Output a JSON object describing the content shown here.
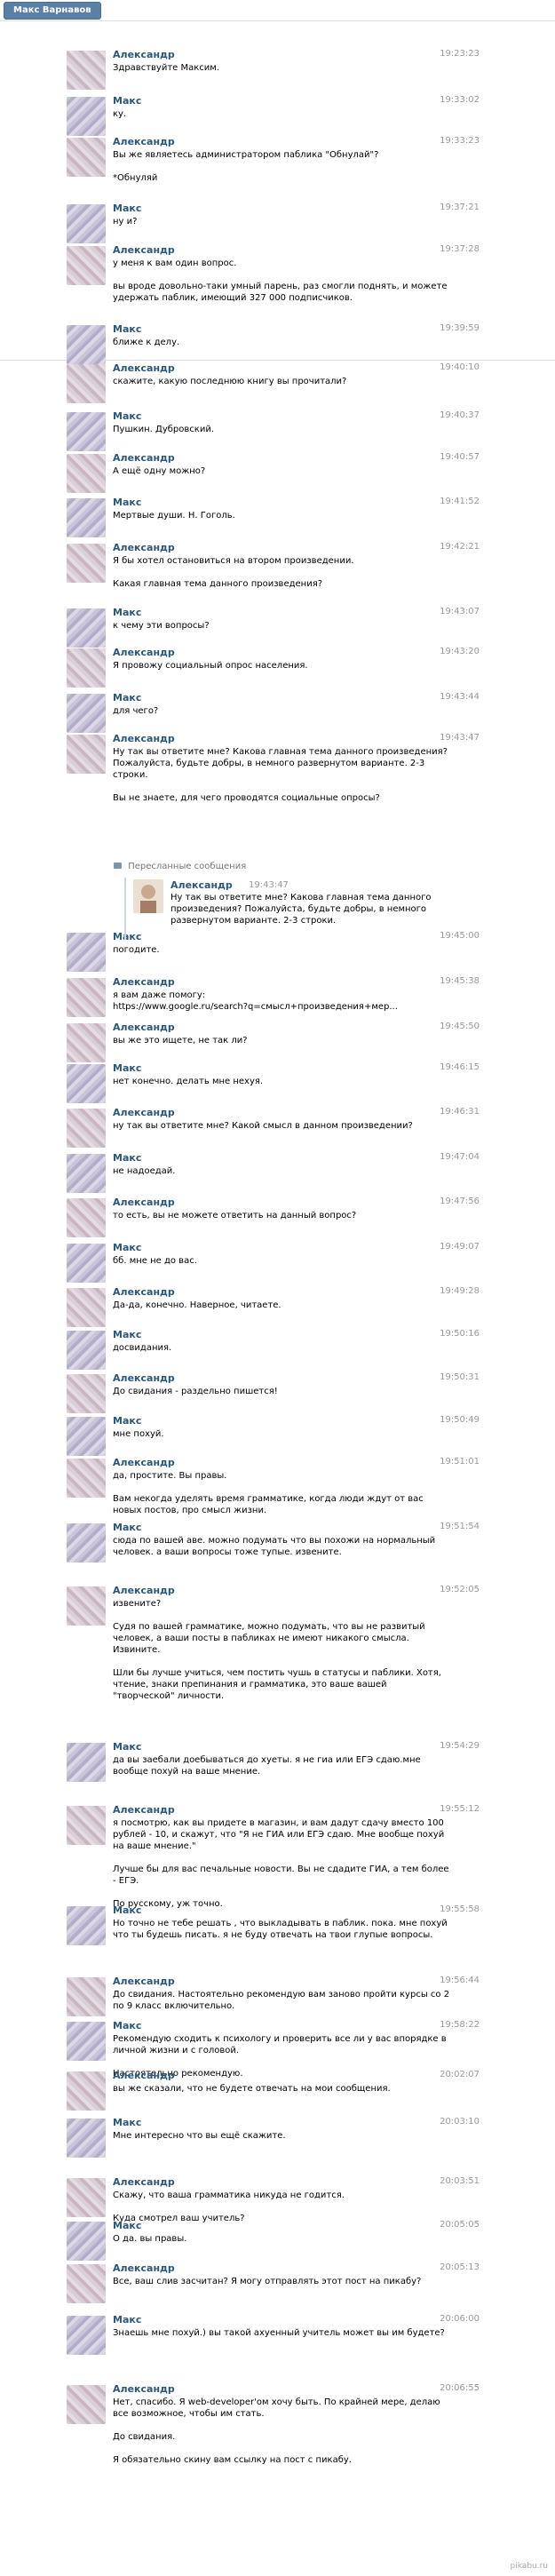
{
  "header": {
    "title": "Макс Варнавов"
  },
  "forwarded": {
    "label": "Пересланные сообщения",
    "author": "Александр",
    "time": "19:43:47",
    "text": "Ну так вы ответите мне? Какова главная тема данного произведения? Пожалуйста, будьте добры, в немного развернутом варианте. 2-3 строки."
  },
  "messages": [
    {
      "author": "Александр",
      "time": "19:23:23",
      "text": "Здравствуйте Максим."
    },
    {
      "author": "Макс",
      "time": "19:33:02",
      "text": "ку."
    },
    {
      "author": "Александр",
      "time": "19:33:23",
      "text": "Вы же являетесь администратором паблика \"Обнулай\"?\n\n*Обнуляй"
    },
    {
      "author": "Макс",
      "time": "19:37:21",
      "text": "ну и?"
    },
    {
      "author": "Александр",
      "time": "19:37:28",
      "text": "у меня к вам один вопрос.\n\nвы вроде довольно-таки умный парень, раз смогли поднять, и можете удержать паблик, имеющий 327 000 подписчиков."
    },
    {
      "author": "Макс",
      "time": "19:39:59",
      "text": "ближе к делу."
    },
    {
      "author": "Александр",
      "time": "19:40:10",
      "text": "скажите, какую последнюю книгу вы прочитали?"
    },
    {
      "author": "Макс",
      "time": "19:40:37",
      "text": "Пушкин. Дубровский."
    },
    {
      "author": "Александр",
      "time": "19:40:57",
      "text": "А ещё одну можно?"
    },
    {
      "author": "Макс",
      "time": "19:41:52",
      "text": "Мертвые души. Н. Гоголь."
    },
    {
      "author": "Александр",
      "time": "19:42:21",
      "text": "Я бы хотел остановиться на втором произведении.\n\nКакая главная тема данного произведения?"
    },
    {
      "author": "Макс",
      "time": "19:43:07",
      "text": "к чему эти вопросы?"
    },
    {
      "author": "Александр",
      "time": "19:43:20",
      "text": "Я провожу социальный опрос населения."
    },
    {
      "author": "Макс",
      "time": "19:43:44",
      "text": "для чего?"
    },
    {
      "author": "Александр",
      "time": "19:43:47",
      "text": "Ну так вы ответите мне? Какова главная тема данного произведения? Пожалуйста, будьте добры, в немного развернутом варианте. 2-3 строки.\n\nВы не знаете, для чего проводятся социальные опросы?"
    },
    {
      "author": "Макс",
      "time": "19:45:00",
      "text": "погодите."
    },
    {
      "author": "Александр",
      "time": "19:45:38",
      "text": "я вам даже помогу:\nhttps://www.google.ru/search?q=смысл+произведения+мер..."
    },
    {
      "author": "Александр",
      "time": "19:45:50",
      "text": "вы же это ищете, не так ли?"
    },
    {
      "author": "Макс",
      "time": "19:46:15",
      "text": "нет конечно. делать мне нехуя."
    },
    {
      "author": "Александр",
      "time": "19:46:31",
      "text": "ну так вы ответите мне? Какой смысл в данном произведении?"
    },
    {
      "author": "Макс",
      "time": "19:47:04",
      "text": "не надоедай."
    },
    {
      "author": "Александр",
      "time": "19:47:56",
      "text": "то есть, вы не можете ответить на данный вопрос?"
    },
    {
      "author": "Макс",
      "time": "19:49:07",
      "text": "бб. мне не до вас."
    },
    {
      "author": "Александр",
      "time": "19:49:28",
      "text": "Да-да, конечно. Наверное, читаете."
    },
    {
      "author": "Макс",
      "time": "19:50:16",
      "text": "досвидания."
    },
    {
      "author": "Александр",
      "time": "19:50:31",
      "text": "До свидания - раздельно пишется!"
    },
    {
      "author": "Макс",
      "time": "19:50:49",
      "text": "мне похуй."
    },
    {
      "author": "Александр",
      "time": "19:51:01",
      "text": "да, простите. Вы правы.\n\nВам некогда уделять время грамматике, когда люди ждут от вас новых постов, про смысл жизни."
    },
    {
      "author": "Макс",
      "time": "19:51:54",
      "text": "сюда по вашей аве. можно подумать что вы похожи на нормальный человек. а ваши вопросы тоже тупые. извените."
    },
    {
      "author": "Александр",
      "time": "19:52:05",
      "text": "извените?\n\nСудя по вашей грамматике, можно подумать, что вы не развитый человек, а ваши посты в пабликах не имеют никакого смысла. Извините.\n\nШли бы лучше учиться, чем постить чушь в статусы и паблики. Хотя, чтение, знаки препинания и грамматика, это ваше вашей \"творческой\" личности."
    },
    {
      "author": "Макс",
      "time": "19:54:29",
      "text": "да вы заебали доебываться до хуеты. я не гиа или ЕГЭ сдаю.мне вообще похуй на ваше мнение."
    },
    {
      "author": "Александр",
      "time": "19:55:12",
      "text": "я посмотрю, как вы придете в магазин, и вам дадут сдачу вместо 100 рублей - 10, и скажут, что \"Я не ГИА или ЕГЭ сдаю. Мне вообще похуй на ваше мнение.\"\n\nЛучше бы для вас печальные новости. Вы не сдадите ГИА, а тем более - ЕГЭ.\n\nПо русскому, уж точно."
    },
    {
      "author": "Макс",
      "time": "19:55:58",
      "text": "Но точно не тебе решать , что выкладывать в паблик. пока. мне похуй что ты будешь писать. я не буду отвечать на твои глупые вопросы."
    },
    {
      "author": "Александр",
      "time": "19:56:44",
      "text": "До свидания. Настоятельно рекомендую вам заново пройти курсы со 2 по 9 класс включительно."
    },
    {
      "author": "Макс",
      "time": "19:58:22",
      "text": "Рекомендую сходить к психологу и проверить все ли у вас впорядке в личной жизни и с головой.\n\nНастоятельно рекомендую."
    },
    {
      "author": "Александр",
      "time": "20:02:07",
      "text": "вы же сказали, что не будете отвечать на мои сообщения."
    },
    {
      "author": "Макс",
      "time": "20:03:10",
      "text": "Мне интересно что вы ещё скажите."
    },
    {
      "author": "Александр",
      "time": "20:03:51",
      "text": "Скажу, что ваша грамматика никуда не годится.\n\nКуда смотрел ваш учитель?"
    },
    {
      "author": "Макс",
      "time": "20:05:05",
      "text": "О да. вы правы."
    },
    {
      "author": "Александр",
      "time": "20:05:13",
      "text": "Все, ваш слив засчитан? Я могу отправлять этот пост на пикабу?"
    },
    {
      "author": "Макс",
      "time": "20:06:00",
      "text": "Знаешь мне похуй.) вы такой ахуенный учитель может вы им будете?"
    },
    {
      "author": "Александр",
      "time": "20:06:55",
      "text": "Нет, спасибо. Я web-developer'ом хочу быть. По крайней мере, делаю все возможное, чтобы им стать.\n\nДо свидания.\n\nЯ обязательно скину вам ссылку на пост с пикабу."
    }
  ],
  "watermark": "pikabu.ru"
}
